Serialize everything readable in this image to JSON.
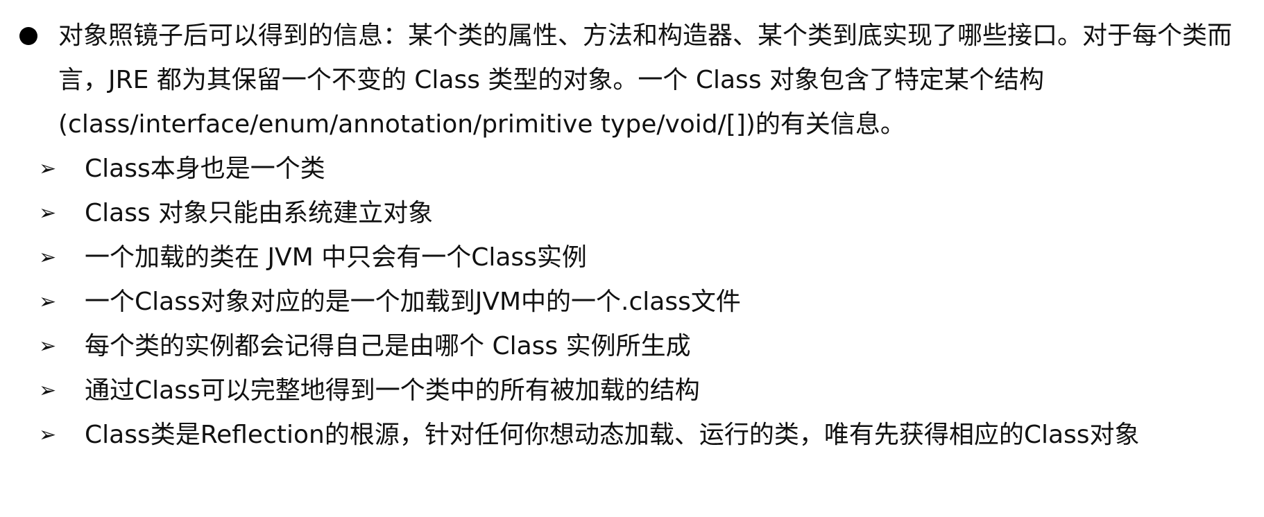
{
  "main": {
    "text": "对象照镜子后可以得到的信息：某个类的属性、方法和构造器、某个类到底实现了哪些接口。对于每个类而言，JRE 都为其保留一个不变的 Class 类型的对象。一个 Class 对象包含了特定某个结构(class/interface/enum/annotation/primitive type/void/[])的有关信息。"
  },
  "items": [
    {
      "text": "Class本身也是一个类"
    },
    {
      "text": "Class 对象只能由系统建立对象"
    },
    {
      "text": "一个加载的类在 JVM 中只会有一个Class实例"
    },
    {
      "text": "一个Class对象对应的是一个加载到JVM中的一个.class文件"
    },
    {
      "text": "每个类的实例都会记得自己是由哪个 Class 实例所生成"
    },
    {
      "text": "通过Class可以完整地得到一个类中的所有被加载的结构"
    },
    {
      "text": "Class类是Reflection的根源，针对任何你想动态加载、运行的类，唯有先获得相应的Class对象"
    }
  ]
}
